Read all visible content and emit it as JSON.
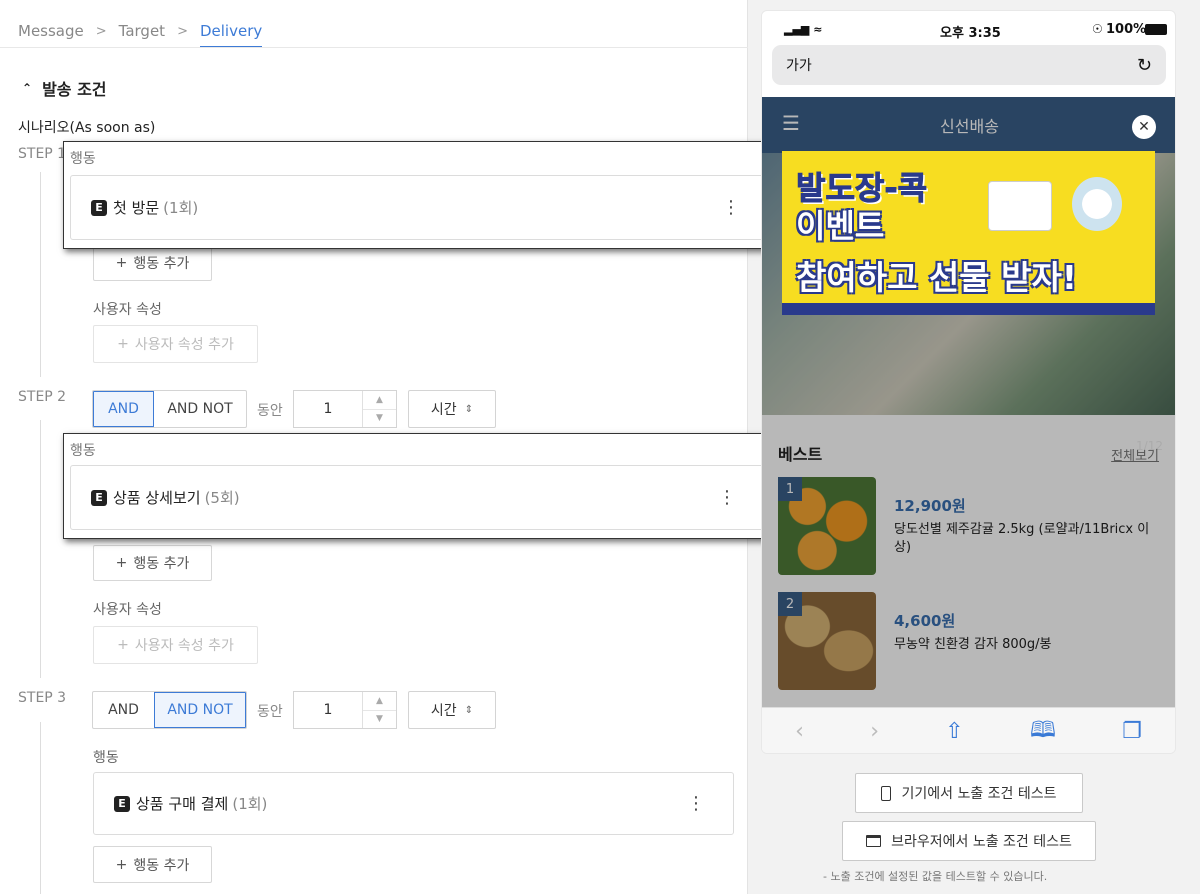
{
  "breadcrumb": {
    "items": [
      "Message",
      "Target",
      "Delivery"
    ]
  },
  "section": {
    "title": "발송 조건"
  },
  "scenario": {
    "label": "시나리오(As soon as)"
  },
  "steps": [
    {
      "label": "STEP 1",
      "action_header": "행동",
      "event_name": "첫 방문",
      "event_count": "(1회)",
      "add_action": "행동 추가",
      "attr_label": "사용자 속성",
      "add_attr": "사용자 속성 추가"
    },
    {
      "label": "STEP 2",
      "op_and": "AND",
      "op_and_not": "AND NOT",
      "selected": "AND",
      "during": "동안",
      "amount": "1",
      "unit": "시간",
      "action_header": "행동",
      "event_name": "상품 상세보기",
      "event_count": "(5회)",
      "add_action": "행동 추가",
      "attr_label": "사용자 속성",
      "add_attr": "사용자 속성 추가"
    },
    {
      "label": "STEP 3",
      "op_and": "AND",
      "op_and_not": "AND NOT",
      "selected": "AND NOT",
      "during": "동안",
      "amount": "1",
      "unit": "시간",
      "action_header": "행동",
      "event_name": "상품 구매 결제",
      "event_count": "(1회)",
      "add_action": "행동 추가"
    }
  ],
  "event_badge": "E",
  "phone": {
    "status": {
      "time": "오후 3:35",
      "battery": "100%"
    },
    "url": "가가",
    "site_title": "신선배송",
    "banner": {
      "line1": "발도장-콕",
      "line2": "이벤트",
      "line3": "참여하고 선물 받자!"
    },
    "pager": "1/12",
    "best_title": "베스트",
    "see_all": "전체보기",
    "products": [
      {
        "rank": "1",
        "price": "12,900원",
        "name": "당도선별 제주감귤 2.5kg (로얄과/11Bricx 이상)"
      },
      {
        "rank": "2",
        "price": "4,600원",
        "name": "무농약 친환경 감자 800g/봉"
      }
    ]
  },
  "test_buttons": {
    "device": "기기에서 노출 조건 테스트",
    "browser": "브라우저에서 노출 조건 테스트",
    "note": "- 노출 조건에 설정된 값을 테스트할 수 있습니다."
  },
  "colors": {
    "accent": "#3d7bd6",
    "site_header": "#3a5f88",
    "banner_yellow": "#f7dd21"
  }
}
